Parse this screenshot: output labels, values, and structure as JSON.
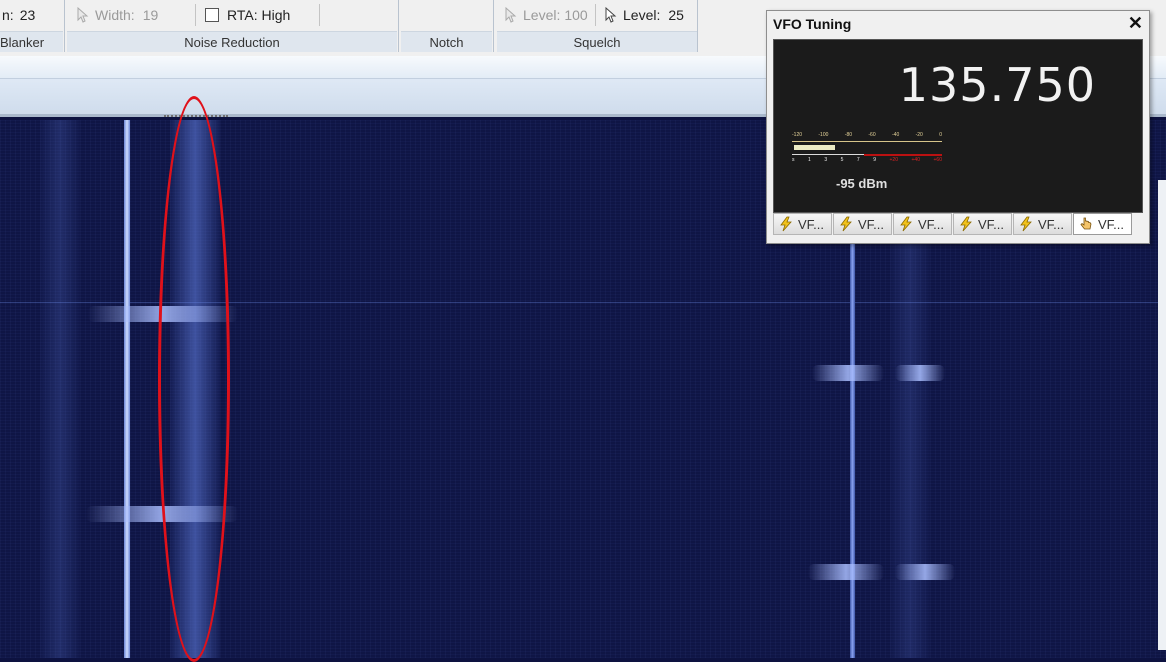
{
  "ribbon": {
    "blanker": {
      "value_label": "n:",
      "value": "23",
      "caption": "Blanker"
    },
    "noise_reduction": {
      "width_label": "Width:",
      "width_value": "19",
      "rta_label": "RTA: High",
      "caption": "Noise Reduction"
    },
    "notch": {
      "caption": "Notch"
    },
    "squelch": {
      "level_a_label": "Level:",
      "level_a_value": "100",
      "level_b_label": "Level:",
      "level_b_value": "25",
      "caption": "Squelch"
    }
  },
  "vfo": {
    "title": "VFO Tuning",
    "close_glyph": "✕",
    "frequency": "135.750",
    "signal_level": "-95 dBm",
    "meter_fill_fraction": 0.27,
    "meter_scale": [
      "-120",
      "-100",
      "-80",
      "-60",
      "-40",
      "-20",
      "0"
    ],
    "meter_s_units_white": [
      "s",
      "1",
      "3",
      "5",
      "7",
      "9"
    ],
    "meter_s_units_red": [
      "+20",
      "+40",
      "+60"
    ],
    "tabs": [
      {
        "label": "VF...",
        "icon": "lightning-icon"
      },
      {
        "label": "VF...",
        "icon": "lightning-icon"
      },
      {
        "label": "VF...",
        "icon": "lightning-icon"
      },
      {
        "label": "VF...",
        "icon": "lightning-icon"
      },
      {
        "label": "VF...",
        "icon": "lightning-icon"
      },
      {
        "label": "VF...",
        "icon": "hand-pointer-icon",
        "active": true
      }
    ]
  },
  "colors": {
    "annotation_ellipse": "#e0111a",
    "waterfall_bg": "#0f1545",
    "signal": "#cfdcff"
  }
}
